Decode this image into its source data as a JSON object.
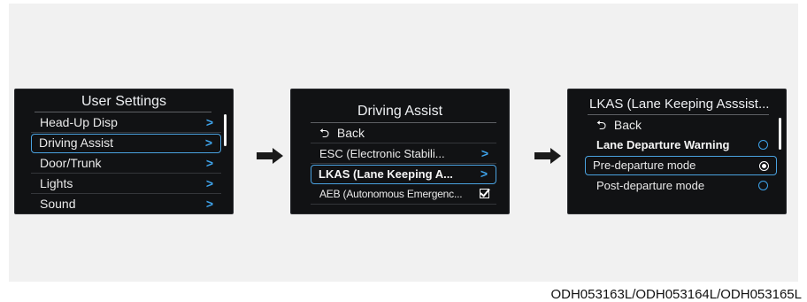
{
  "screens": {
    "user_settings": {
      "title": "User Settings",
      "items": [
        {
          "label": "Head-Up Disp",
          "chevron": ">"
        },
        {
          "label": "Driving Assist",
          "chevron": ">",
          "selected": true
        },
        {
          "label": "Door/Trunk",
          "chevron": ">"
        },
        {
          "label": "Lights",
          "chevron": ">"
        },
        {
          "label": "Sound",
          "chevron": ">"
        }
      ]
    },
    "driving_assist": {
      "title": "Driving Assist",
      "back_label": "Back",
      "items": [
        {
          "label": "ESC (Electronic Stabili...",
          "chevron": ">"
        },
        {
          "label": "LKAS (Lane Keeping A...",
          "chevron": ">",
          "selected": true
        },
        {
          "label": "AEB (Autonomous Emergenc...",
          "checked": true
        }
      ]
    },
    "lkas": {
      "title": "LKAS (Lane Keeping Asssist...",
      "back_label": "Back",
      "items": [
        {
          "label": "Lane Departure Warning",
          "radio": false,
          "bold": true
        },
        {
          "label": "Pre-departure mode",
          "radio": true,
          "selected": true
        },
        {
          "label": "Post-departure mode",
          "radio": false
        }
      ]
    }
  },
  "icons": {
    "back": "back-arrow-icon",
    "next": "chevron-right-icon",
    "flow": "right-arrow-icon"
  },
  "colors": {
    "accent": "#3ea3ea",
    "screen_bg": "#111214"
  },
  "caption": "ODH053163L/ODH053164L/ODH053165L"
}
